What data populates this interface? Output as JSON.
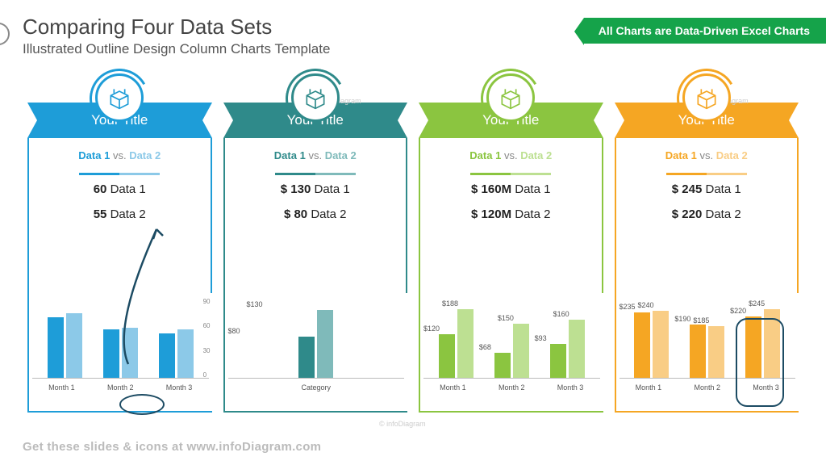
{
  "title": "Comparing Four Data Sets",
  "subtitle": "Illustrated Outline Design Column Charts Template",
  "badge": "All Charts are Data-Driven Excel Charts",
  "footer": "Get these slides & icons at www.infoDiagram.com",
  "watermark": "© infoDiagram",
  "panels": [
    {
      "title": "Your Title",
      "vs1": "Data 1",
      "vs2": "Data 2",
      "stat1": "60",
      "stat1_label": "Data 1",
      "stat2": "55",
      "stat2_label": "Data 2",
      "color": "#1e9dd8",
      "light": "#8cc9e8"
    },
    {
      "title": "Your Title",
      "vs1": "Data 1",
      "vs2": "Data 2",
      "stat1": "$ 130",
      "stat1_label": "Data 1",
      "stat2": "$ 80",
      "stat2_label": "Data 2",
      "color": "#2f8a8a",
      "light": "#7fbaba"
    },
    {
      "title": "Your Title",
      "vs1": "Data 1",
      "vs2": "Data 2",
      "stat1": "$ 160M",
      "stat1_label": "Data 1",
      "stat2": "$ 120M",
      "stat2_label": "Data 2",
      "color": "#8bc540",
      "light": "#bde092"
    },
    {
      "title": "Your Title",
      "vs1": "Data 1",
      "vs2": "Data 2",
      "stat1": "$ 245",
      "stat1_label": "Data 1",
      "stat2": "$ 220",
      "stat2_label": "Data 2",
      "color": "#f5a623",
      "light": "#f9cd85"
    }
  ],
  "chart_data": [
    {
      "type": "bar",
      "categories": [
        "Month 1",
        "Month 2",
        "Month 3"
      ],
      "series": [
        {
          "name": "Data 1",
          "values": [
            75,
            60,
            55
          ]
        },
        {
          "name": "Data 2",
          "values": [
            80,
            62,
            60
          ]
        }
      ],
      "ylim": [
        0,
        90
      ],
      "yticks": [
        0,
        30,
        60,
        90
      ]
    },
    {
      "type": "bar",
      "categories": [
        "Category"
      ],
      "series": [
        {
          "name": "Data 2",
          "values": [
            80
          ],
          "labels": [
            "$80"
          ]
        },
        {
          "name": "Data 1",
          "values": [
            130
          ],
          "labels": [
            "$130"
          ]
        }
      ],
      "ylim": [
        0,
        140
      ]
    },
    {
      "type": "bar",
      "categories": [
        "Month 1",
        "Month 2",
        "Month 3"
      ],
      "series": [
        {
          "name": "Data 2",
          "values": [
            120,
            68,
            93
          ],
          "labels": [
            "$120",
            "$68",
            "$93"
          ]
        },
        {
          "name": "Data 1",
          "values": [
            188,
            150,
            160
          ],
          "labels": [
            "$188",
            "$150",
            "$160"
          ]
        }
      ],
      "ylim": [
        0,
        200
      ]
    },
    {
      "type": "bar",
      "categories": [
        "Month 1",
        "Month 2",
        "Month 3"
      ],
      "series": [
        {
          "name": "Data 2",
          "values": [
            235,
            190,
            220
          ],
          "labels": [
            "$235",
            "$190",
            "$220"
          ]
        },
        {
          "name": "Data 1",
          "values": [
            240,
            185,
            245
          ],
          "labels": [
            "$240",
            "$185",
            "$245"
          ]
        }
      ],
      "ylim": [
        0,
        260
      ]
    }
  ]
}
